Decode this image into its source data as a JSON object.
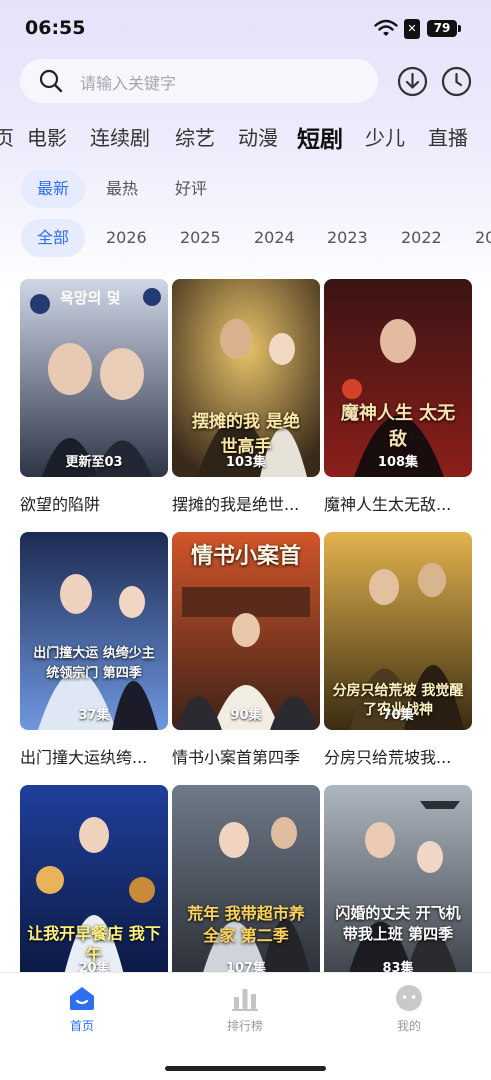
{
  "status_bar": {
    "time": "06:55",
    "battery": "79",
    "sim_label": "✕"
  },
  "search": {
    "placeholder": "请输入关键字"
  },
  "category_tabs": [
    {
      "label": "页"
    },
    {
      "label": "电影"
    },
    {
      "label": "连续剧"
    },
    {
      "label": "综艺"
    },
    {
      "label": "动漫"
    },
    {
      "label": "短剧",
      "active": true
    },
    {
      "label": "少儿"
    },
    {
      "label": "直播"
    }
  ],
  "sort_filters": [
    {
      "label": "最新",
      "active": true
    },
    {
      "label": "最热"
    },
    {
      "label": "好评"
    }
  ],
  "year_filters": [
    {
      "label": "全部",
      "active": true
    },
    {
      "label": "2026"
    },
    {
      "label": "2025"
    },
    {
      "label": "2024"
    },
    {
      "label": "2023"
    },
    {
      "label": "2022"
    },
    {
      "label": "20"
    }
  ],
  "cards": [
    {
      "title": "欲望的陷阱",
      "episodes": "更新至03",
      "poster_text": "욕망의 덫",
      "accent": "#6f8bc4"
    },
    {
      "title": "摆摊的我是绝世...",
      "episodes": "103集",
      "poster_text": "摆摊的我 是绝世高手",
      "accent": "#c7a251"
    },
    {
      "title": "魔神人生太无敌...",
      "episodes": "108集",
      "poster_text": "魔神人生 太无敌",
      "accent": "#b83a2c"
    },
    {
      "title": "出门撞大运纨绔...",
      "episodes": "37集",
      "poster_text": "出门撞大运 纨绔少主统领宗门 第四季",
      "accent": "#4a74c6"
    },
    {
      "title": "情书小案首第四季",
      "episodes": "90集",
      "poster_text": "情书小案首",
      "accent": "#c85a2a"
    },
    {
      "title": "分房只给荒坡我...",
      "episodes": "70集",
      "poster_text": "分房只给荒坡 我觉醒了农业战神",
      "accent": "#c99a3c"
    },
    {
      "title": "",
      "episodes": "20集",
      "poster_text": "让我开早餐店 我下午",
      "accent": "#3a5fc4"
    },
    {
      "title": "",
      "episodes": "107集",
      "poster_text": "荒年 我带超市养全家 第二季",
      "accent": "#d8a23a"
    },
    {
      "title": "",
      "episodes": "83集",
      "poster_text": "闪婚的丈夫 开飞机带我上班 第四季",
      "accent": "#5c6a78"
    }
  ],
  "bottom_nav": [
    {
      "label": "首页",
      "active": true
    },
    {
      "label": "排行榜"
    },
    {
      "label": "我的"
    }
  ],
  "colors": {
    "accent": "#2e6ff2",
    "chip_bg": "#e6ecfd"
  }
}
